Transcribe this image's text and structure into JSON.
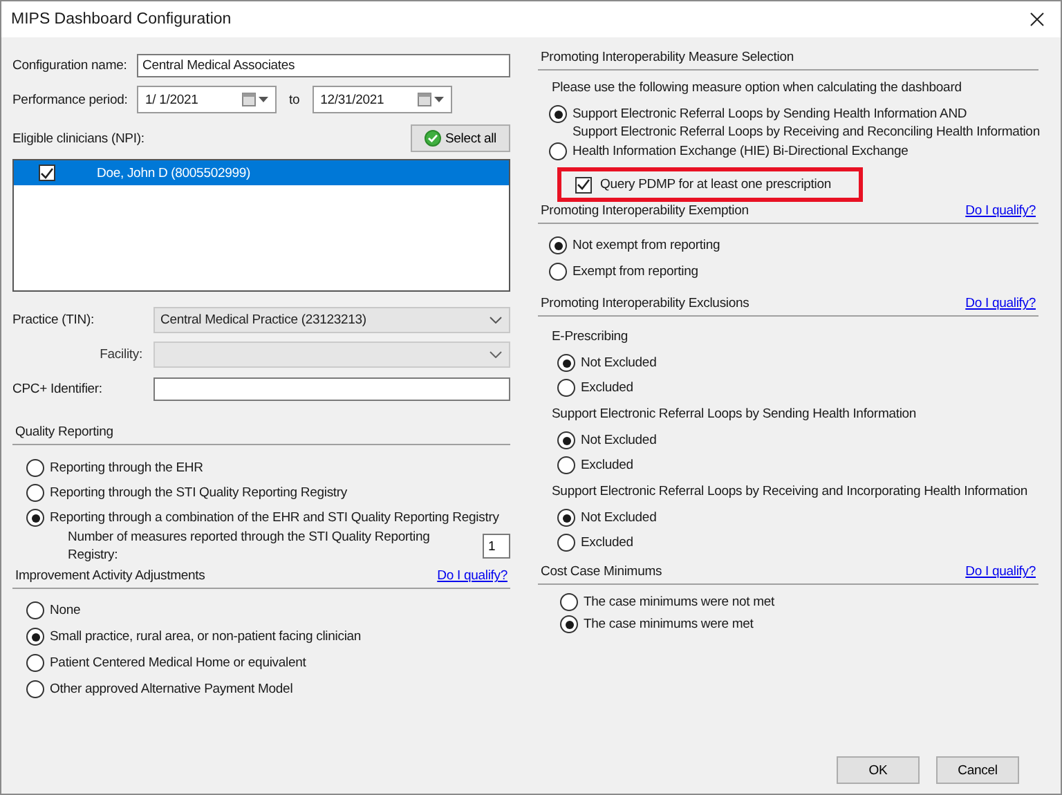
{
  "window": {
    "title": "MIPS Dashboard Configuration"
  },
  "left": {
    "config_name": {
      "label": "Configuration name:",
      "value": "Central Medical Associates"
    },
    "performance_period": {
      "label": "Performance period:",
      "start": "1/ 1/2021",
      "separator": "to",
      "end": "12/31/2021"
    },
    "clinicians": {
      "label": "Eligible clinicians (NPI):",
      "select_all": "Select all",
      "items": [
        {
          "name": "Doe, John D (8005502999)",
          "checked": true,
          "selected": true
        }
      ]
    },
    "practice": {
      "label": "Practice (TIN):",
      "value": "Central Medical Practice (23123213)"
    },
    "facility": {
      "label": "Facility:",
      "disabled": true
    },
    "cpc": {
      "label": "CPC+ Identifier:"
    },
    "quality_reporting": {
      "title": "Quality Reporting",
      "options": [
        {
          "label": "Reporting through the EHR",
          "selected": false
        },
        {
          "label": "Reporting through the STI Quality Reporting Registry",
          "selected": false
        },
        {
          "label": "Reporting through a combination of the EHR and STI Quality Reporting Registry",
          "selected": true
        }
      ],
      "measures": {
        "label": "Number of measures reported through the STI Quality Reporting Registry:",
        "value": "1"
      }
    },
    "improvement": {
      "title": "Improvement Activity Adjustments",
      "link": "Do I qualify?",
      "options": [
        {
          "label": "None",
          "selected": false
        },
        {
          "label": "Small practice, rural area, or non-patient facing clinician",
          "selected": true
        },
        {
          "label": "Patient Centered Medical Home or equivalent",
          "selected": false
        },
        {
          "label": "Other approved Alternative Payment Model",
          "selected": false
        }
      ]
    }
  },
  "right": {
    "measure_selection": {
      "title": "Promoting Interoperability Measure Selection",
      "intro": "Please use the following measure option when calculating the dashboard",
      "options": [
        {
          "lines": [
            "Support Electronic Referral Loops by Sending Health Information AND",
            "Support Electronic Referral Loops by Receiving and Reconciling Health Information"
          ],
          "selected": true
        },
        {
          "lines": [
            "Health Information Exchange (HIE) Bi-Directional Exchange"
          ],
          "selected": false
        }
      ],
      "pdmp": {
        "label": "Query PDMP for at least one prescription",
        "checked": true,
        "highlighted": true
      }
    },
    "exemption": {
      "title": "Promoting Interoperability Exemption",
      "link": "Do I qualify?",
      "options": [
        {
          "label": "Not exempt from reporting",
          "selected": true
        },
        {
          "label": "Exempt from reporting",
          "selected": false
        }
      ]
    },
    "exclusions": {
      "title": "Promoting Interoperability Exclusions",
      "link": "Do I qualify?",
      "groups": [
        {
          "title": "E-Prescribing",
          "options": [
            {
              "label": "Not Excluded",
              "selected": true
            },
            {
              "label": "Excluded",
              "selected": false
            }
          ]
        },
        {
          "title": "Support Electronic Referral Loops by Sending Health Information",
          "options": [
            {
              "label": "Not Excluded",
              "selected": true
            },
            {
              "label": "Excluded",
              "selected": false
            }
          ]
        },
        {
          "title": "Support Electronic Referral Loops by Receiving and Incorporating Health Information",
          "options": [
            {
              "label": "Not Excluded",
              "selected": true
            },
            {
              "label": "Excluded",
              "selected": false
            }
          ]
        }
      ]
    },
    "cost": {
      "title": "Cost Case Minimums",
      "link": "Do I qualify?",
      "options": [
        {
          "label": "The case minimums were not met",
          "selected": false
        },
        {
          "label": "The case minimums were met",
          "selected": true
        }
      ]
    }
  },
  "buttons": [
    {
      "label": "OK"
    },
    {
      "label": "Cancel"
    }
  ]
}
